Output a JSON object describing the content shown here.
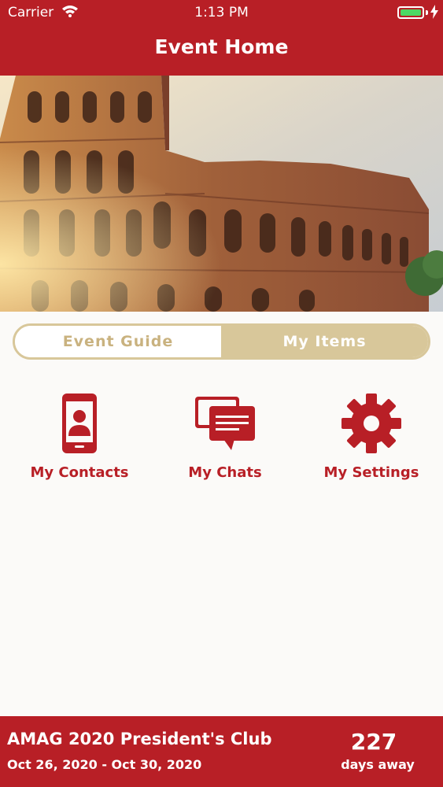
{
  "status": {
    "carrier": "Carrier",
    "time": "1:13 PM"
  },
  "header": {
    "title": "Event Home"
  },
  "segment": {
    "left": "Event Guide",
    "right": "My Items",
    "selected": "right"
  },
  "tiles": [
    {
      "label": "My Contacts",
      "icon": "phone-contact-icon"
    },
    {
      "label": "My Chats",
      "icon": "chat-bubbles-icon"
    },
    {
      "label": "My Settings",
      "icon": "gear-icon"
    }
  ],
  "footer": {
    "event_name": "AMAG 2020 President's Club",
    "dates": "Oct 26, 2020 - Oct 30, 2020",
    "days_count": "227",
    "days_label": "days away"
  },
  "colors": {
    "brand_red": "#b81f26",
    "gold": "#d8c79a"
  }
}
